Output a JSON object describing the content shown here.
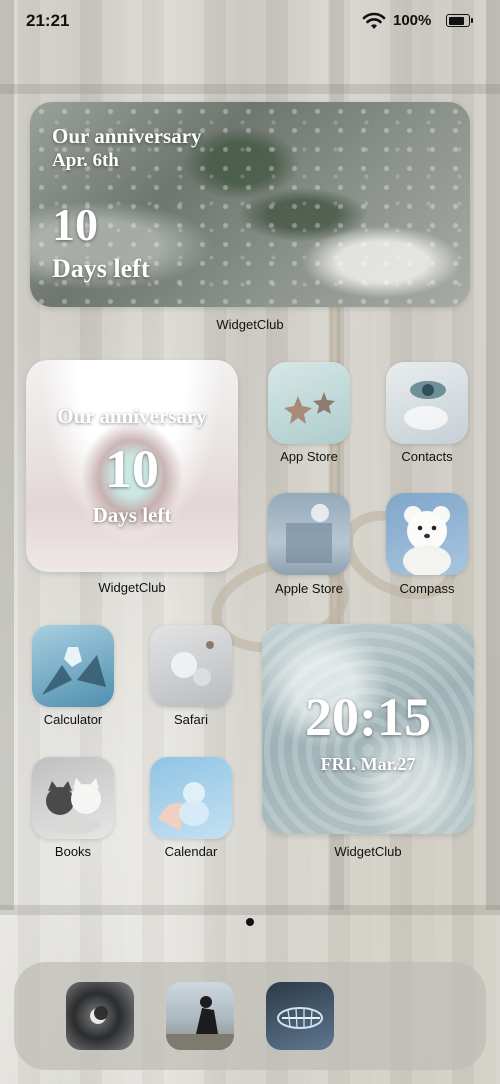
{
  "status_bar": {
    "time": "21:21",
    "battery_percent": "100%",
    "wifi_icon": "wifi-icon",
    "battery_icon": "battery-icon"
  },
  "widgets": {
    "rain": {
      "line1": "Our anniversary",
      "line2": "Apr. 6th",
      "count": "10",
      "line3": "Days left",
      "caption": "WidgetClub"
    },
    "eye": {
      "line1": "Our anniversary",
      "count": "10",
      "line3": "Days left",
      "caption": "WidgetClub"
    },
    "clock": {
      "time": "20:15",
      "date": "FRI. Mar.27",
      "caption": "WidgetClub"
    }
  },
  "apps": {
    "app_store": "App Store",
    "contacts": "Contacts",
    "apple_store": "Apple Store",
    "compass": "Compass",
    "calculator": "Calculator",
    "safari": "Safari",
    "books": "Books",
    "calendar": "Calendar"
  },
  "page_indicator": {
    "current_page": 1,
    "total_pages": 1
  },
  "dock": {
    "items": [
      "moon-photo-icon",
      "seated-figure-icon",
      "fish-skeleton-icon"
    ]
  }
}
